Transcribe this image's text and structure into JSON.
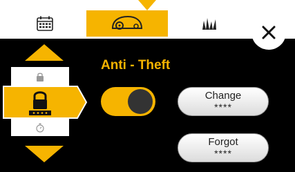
{
  "header": {
    "tabs": [
      {
        "icon": "calendar-icon",
        "active": false
      },
      {
        "icon": "robot-mower-icon",
        "active": true
      },
      {
        "icon": "grass-icon",
        "active": false
      }
    ],
    "close_icon": "close-icon"
  },
  "side_menu": {
    "items": [
      {
        "icon": "lock-small-icon",
        "active": false
      },
      {
        "icon": "lock-pin-icon",
        "active": true
      },
      {
        "icon": "timer-icon",
        "active": false
      }
    ]
  },
  "main": {
    "title": "Anti - Theft",
    "toggle": {
      "on": true
    },
    "change_button": {
      "label": "Change",
      "mask": "****"
    },
    "forgot_button": {
      "label": "Forgot",
      "mask": "****"
    }
  },
  "colors": {
    "accent": "#f6b400",
    "background": "#000000",
    "knob": "#333333"
  }
}
